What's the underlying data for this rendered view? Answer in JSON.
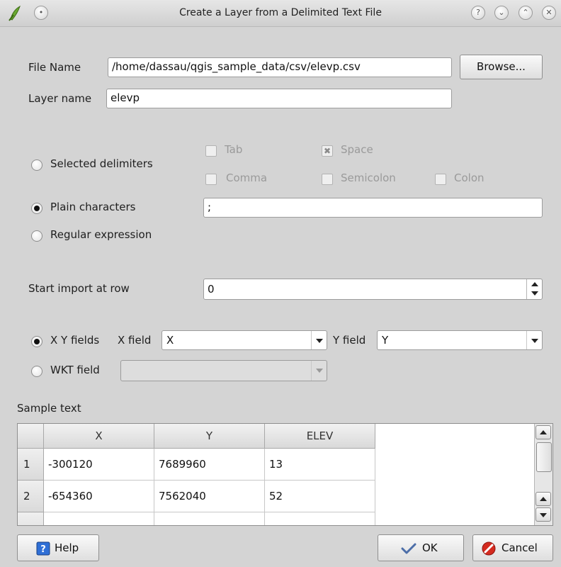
{
  "window": {
    "title": "Create a Layer from a Delimited Text File"
  },
  "file": {
    "name_label": "File Name",
    "name_value": "/home/dassau/qgis_sample_data/csv/elevp.csv",
    "browse_label": "Browse...",
    "layer_label": "Layer name",
    "layer_value": "elevp"
  },
  "delimiters": {
    "selected_label": "Selected delimiters",
    "plain_label": "Plain characters",
    "plain_value": ";",
    "regex_label": "Regular expression",
    "options": {
      "tab": "Tab",
      "space": "Space",
      "comma": "Comma",
      "semicolon": "Semicolon",
      "colon": "Colon"
    },
    "space_checked_glyph": "✖"
  },
  "start_row": {
    "label": "Start import at row",
    "value": "0"
  },
  "geometry": {
    "xy_label": "X Y fields",
    "x_field_label": "X field",
    "x_field_value": "X",
    "y_field_label": "Y field",
    "y_field_value": "Y",
    "wkt_label": "WKT field",
    "wkt_value": ""
  },
  "sample": {
    "label": "Sample text",
    "columns": [
      "X",
      "Y",
      "ELEV"
    ],
    "rows": [
      {
        "num": "1",
        "cells": [
          "-300120",
          "7689960",
          "13"
        ]
      },
      {
        "num": "2",
        "cells": [
          "-654360",
          "7562040",
          "52"
        ]
      }
    ]
  },
  "footer": {
    "help_label": "Help",
    "ok_label": "OK",
    "cancel_label": "Cancel"
  }
}
